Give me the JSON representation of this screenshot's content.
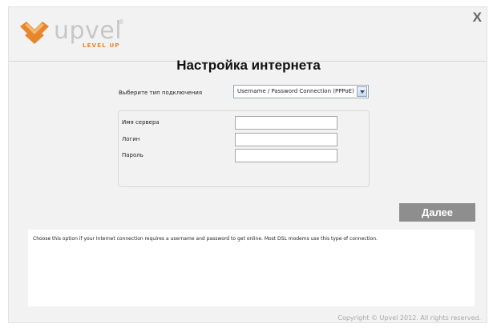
{
  "header": {
    "logo_text": "upvel",
    "logo_registered": "®",
    "logo_tagline": "LEVEL UP",
    "close_label": "X"
  },
  "page": {
    "title": "Настройка интернета"
  },
  "connection_type": {
    "label": "Выберите тип подключения",
    "selected": "Username / Password Connection (PPPoE)"
  },
  "fields": {
    "server_name": {
      "label": "Имя сервера",
      "value": ""
    },
    "login": {
      "label": "Логин",
      "value": ""
    },
    "password": {
      "label": "Пароль",
      "value": ""
    }
  },
  "actions": {
    "next_label": "Далее"
  },
  "help": {
    "text": "Choose this option if your Internet connection requires a username and password to get online. Most DSL modems use this type of connection."
  },
  "footer": {
    "copyright": "Copyright © Upvel 2012. All rights reserved."
  },
  "colors": {
    "brand_orange": "#e7862a",
    "brand_gray": "#c7c7c7",
    "button_gray": "#8e8e8e"
  }
}
